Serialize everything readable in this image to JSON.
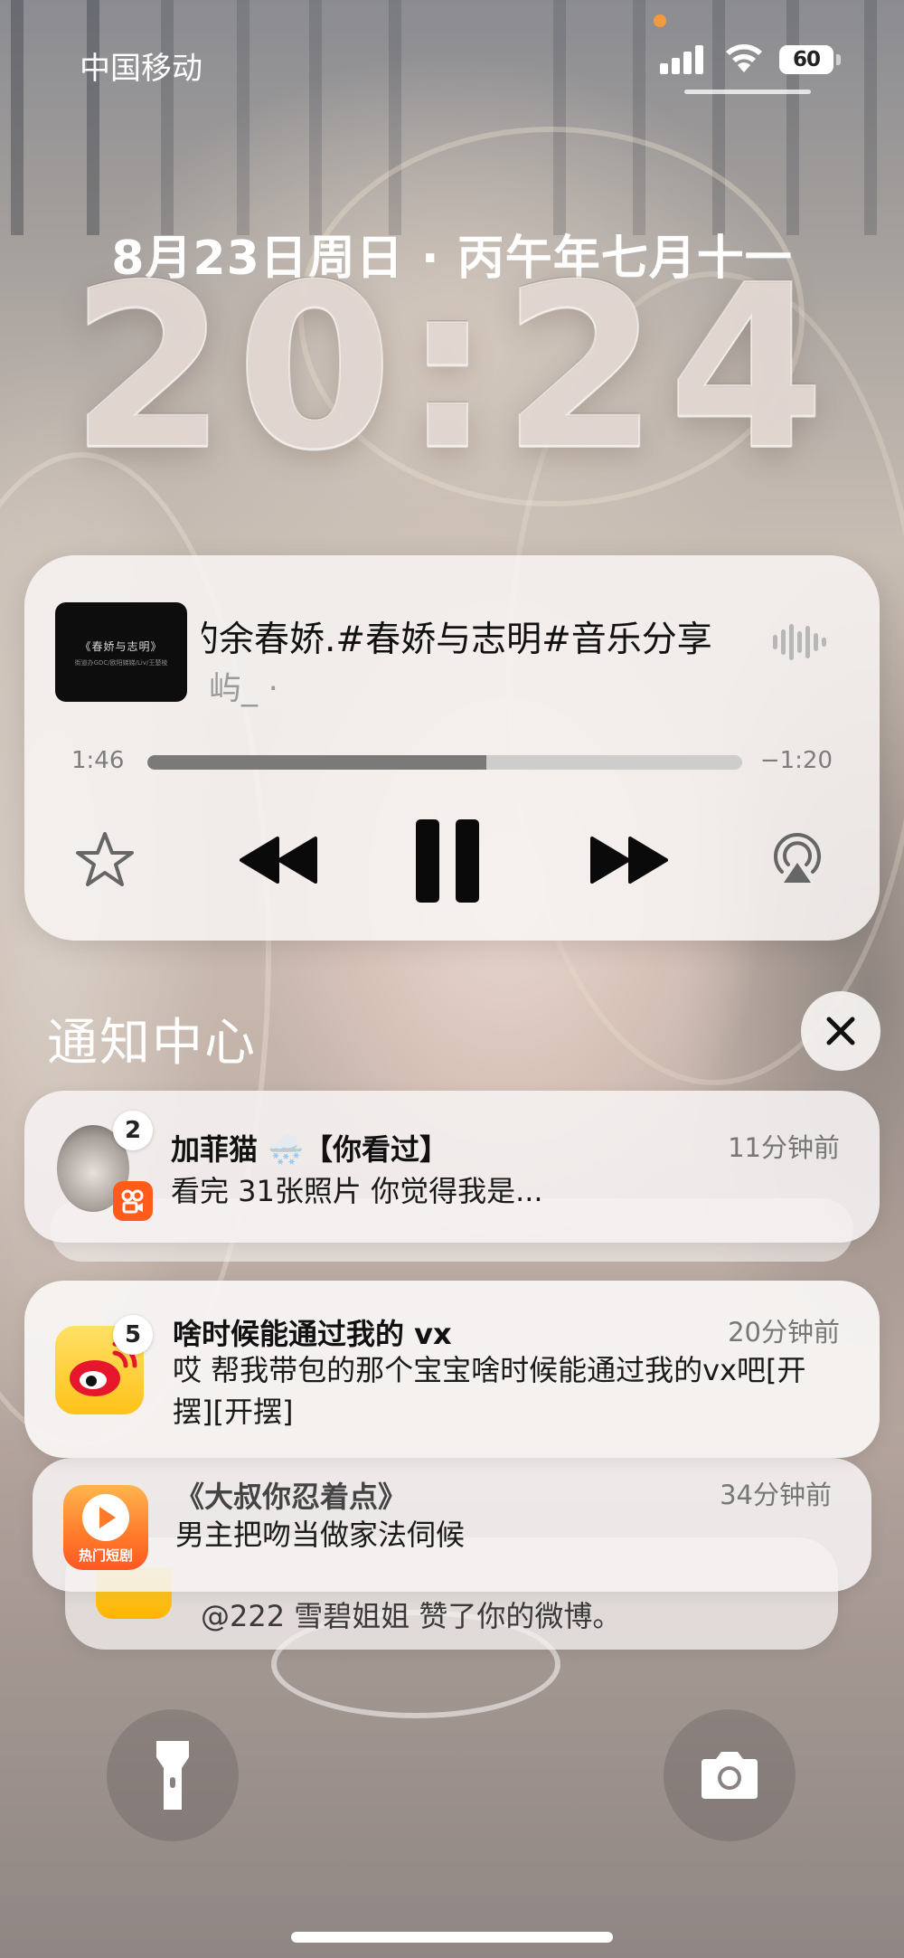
{
  "status_bar": {
    "carrier": "中国移动",
    "battery": "60",
    "icons": [
      "signal-icon",
      "wifi-icon",
      "battery-icon"
    ]
  },
  "lock_screen": {
    "date": "8月23日周日 · 丙午年七月十一",
    "time": "20:24"
  },
  "now_playing": {
    "album_art_text": "《春娇与志明》",
    "album_art_subtext": "街道办GDC/欧阳娣娣/Liv/王楚棱",
    "title": "的余春娇.#春娇与志明#音乐分享",
    "artist": "屿_ ·",
    "elapsed": "1:46",
    "remaining": "−1:20",
    "progress": 0.57,
    "controls": [
      "star-icon",
      "rewind-icon",
      "pause-icon",
      "fast-forward-icon",
      "airplay-icon"
    ]
  },
  "notification_center": {
    "title": "通知中心",
    "notifications": [
      {
        "app_icon": "kuaishou-icon",
        "badge": "2",
        "title": "加菲猫 🌨️【你看过】",
        "time": "11分钟前",
        "body": "看完 31张照片 你觉得我是..."
      },
      {
        "app_icon": "weibo-icon",
        "badge": "5",
        "title": "啥时候能通过我的 vx",
        "time": "20分钟前",
        "body": "哎 帮我带包的那个宝宝啥时候能通过我的vx吧[开摆][开摆]"
      },
      {
        "app_icon": "hot-drama-icon",
        "app_icon_label": "热门短剧",
        "title": "《大叔你忍着点》",
        "time": "34分钟前",
        "body": "男主把吻当做家法伺候"
      },
      {
        "app_icon": "weibo-icon",
        "body": "@222 雪碧姐姐 赞了你的微博。"
      }
    ]
  },
  "bottom": {
    "left_button": "flashlight-icon",
    "right_button": "camera-icon"
  }
}
